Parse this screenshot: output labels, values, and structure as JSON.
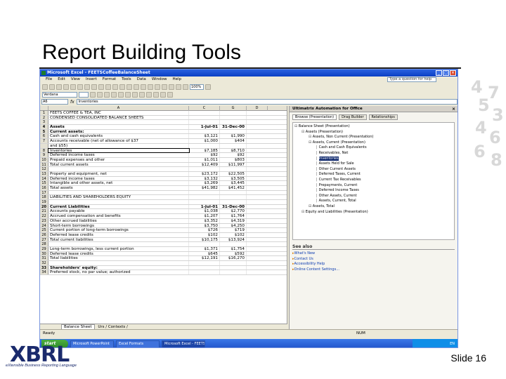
{
  "slide": {
    "title": "Report Building Tools",
    "slide_number": "Slide 16",
    "logo_text": "XBRL",
    "logo_subtitle": "eXtensible Business Reporting Language",
    "deco_digits": [
      "4",
      "7",
      "5",
      "3",
      "4",
      "6",
      "6",
      "8"
    ]
  },
  "excel": {
    "window_title": "Microsoft Excel - FEETSCoffeeBalanceSheet",
    "menu": [
      "File",
      "Edit",
      "View",
      "Insert",
      "Format",
      "Tools",
      "Data",
      "Window",
      "Help"
    ],
    "help_box": "Type a question for help",
    "font_select": "Verdana",
    "zoom": "100%",
    "name_box": "A6",
    "formula": "Inventories",
    "columns": [
      "A",
      "C",
      "G",
      "D"
    ],
    "rows": [
      {
        "n": "1",
        "a": "FEETS COFFEE & TEA, INC",
        "c": "",
        "d": ""
      },
      {
        "n": "2",
        "a": "CONDENSED CONSOLIDATED BALANCE SHEETS",
        "c": "",
        "d": ""
      },
      {
        "n": "3",
        "a": "",
        "c": "",
        "d": ""
      },
      {
        "n": "4",
        "a": "Assets",
        "c": "1-Jul-01",
        "d": "31-Dec-00",
        "bold": true
      },
      {
        "n": "5",
        "a": "Current assets:",
        "c": "",
        "d": "",
        "bold": true
      },
      {
        "n": "6",
        "a": "Cash and cash equivalents",
        "c": "$3,121",
        "d": "$1,990"
      },
      {
        "n": "7",
        "a": "Accounts receivable (net of allowance of $37",
        "c": "$1,000",
        "d": "$404"
      },
      {
        "n": "",
        "a": "and $55)",
        "c": "",
        "d": ""
      },
      {
        "n": "8",
        "a": "Inventories",
        "c": "$7,185",
        "d": "$8,710",
        "sel": true
      },
      {
        "n": "9",
        "a": "Deferred income taxes",
        "c": "$92",
        "d": "$92"
      },
      {
        "n": "10",
        "a": "Prepaid expenses and other",
        "c": "$1,011",
        "d": "$803"
      },
      {
        "n": "11",
        "a": "Total current assets",
        "c": "$12,409",
        "d": "$11,997"
      },
      {
        "n": "12",
        "a": "",
        "c": "",
        "d": ""
      },
      {
        "n": "13",
        "a": "Property and equipment, net",
        "c": "$23,172",
        "d": "$22,505"
      },
      {
        "n": "14",
        "a": "Deferred income taxes",
        "c": "$3,132",
        "d": "$3,505"
      },
      {
        "n": "15",
        "a": "Intangible and other assets, net",
        "c": "$3,269",
        "d": "$3,445"
      },
      {
        "n": "16",
        "a": "Total assets",
        "c": "$41,982",
        "d": "$41,452"
      },
      {
        "n": "17",
        "a": "",
        "c": "",
        "d": ""
      },
      {
        "n": "18",
        "a": "LIABILITIES AND SHAREHOLDERS EQUITY",
        "c": "",
        "d": ""
      },
      {
        "n": "19",
        "a": "",
        "c": "",
        "d": ""
      },
      {
        "n": "20",
        "a": "Current Liabilities",
        "c": "1-Jul-01",
        "d": "31-Dec-00",
        "bold": true
      },
      {
        "n": "21",
        "a": "Accounts payable",
        "c": "$1,038",
        "d": "$2,770"
      },
      {
        "n": "22",
        "a": "Accrued compensation and benefits",
        "c": "$1,207",
        "d": "$1,764"
      },
      {
        "n": "23",
        "a": "Other accrued liabilities",
        "c": "$3,352",
        "d": "$4,319"
      },
      {
        "n": "24",
        "a": "Short-term borrowings",
        "c": "$3,750",
        "d": "$4,250"
      },
      {
        "n": "25",
        "a": "Current portion of long-term borrowings",
        "c": "$726",
        "d": "$719"
      },
      {
        "n": "26",
        "a": "Deferred lease credits",
        "c": "$102",
        "d": "$102"
      },
      {
        "n": "27",
        "a": "Total current liabilities",
        "c": "$10,175",
        "d": "$13,924"
      },
      {
        "n": "28",
        "a": "",
        "c": "",
        "d": ""
      },
      {
        "n": "29",
        "a": "Long-term borrowings, less current portion",
        "c": "$1,371",
        "d": "$1,754"
      },
      {
        "n": "30",
        "a": "Deferred lease credits",
        "c": "$645",
        "d": "$592"
      },
      {
        "n": "31",
        "a": "Total liabilities",
        "c": "$12,191",
        "d": "$16,270"
      },
      {
        "n": "32",
        "a": "",
        "c": "",
        "d": ""
      },
      {
        "n": "33",
        "a": "Shareholders' equity:",
        "c": "",
        "d": "",
        "bold": true
      },
      {
        "n": "34",
        "a": "Preferred stock, no par value; authorized",
        "c": "",
        "d": ""
      }
    ],
    "sheet_tab": "Balance Sheet",
    "other_tabs": "Urs / Contexts /",
    "status": "Ready",
    "status_right": "NUM"
  },
  "taskpane": {
    "title": "Ultimatrix Automation for Office",
    "close": "×",
    "tabs": [
      "Browse (Presentation)",
      "Drag Builder",
      "Relationships"
    ],
    "tree": [
      {
        "text": "Balance Sheet (Presentation)",
        "indent": 0
      },
      {
        "text": "Assets (Presentation)",
        "indent": 1
      },
      {
        "text": "Assets, Non Current (Presentation)",
        "indent": 2
      },
      {
        "text": "Assets, Current (Presentation)",
        "indent": 2
      },
      {
        "text": "Cash and Cash Equivalents",
        "indent": 3
      },
      {
        "text": "Receivables, Net",
        "indent": 3
      },
      {
        "text": "Inventories",
        "indent": 3,
        "selected": true
      },
      {
        "text": "Assets Held for Sale",
        "indent": 3
      },
      {
        "text": "Other Current Assets",
        "indent": 3
      },
      {
        "text": "Deferred Taxes, Current",
        "indent": 3
      },
      {
        "text": "Current Tax Receivables",
        "indent": 3
      },
      {
        "text": "Prepayments, Current",
        "indent": 3
      },
      {
        "text": "Deferred Income Taxes",
        "indent": 3
      },
      {
        "text": "Other Assets, Current",
        "indent": 3
      },
      {
        "text": "Assets, Current, Total",
        "indent": 3
      },
      {
        "text": "Assets, Total",
        "indent": 2
      },
      {
        "text": "Equity and Liabilities (Presentation)",
        "indent": 1
      }
    ],
    "see_also_title": "See also",
    "see_also": [
      "What's New",
      "Contact Us",
      "Accessibility Help",
      "Online Content Settings..."
    ]
  },
  "taskbar": {
    "start": "start",
    "items": [
      "Microsoft PowerPoint",
      "Excel Formats",
      "Microsoft Excel - FEETS"
    ],
    "active_index": 2,
    "tray": "EN"
  }
}
